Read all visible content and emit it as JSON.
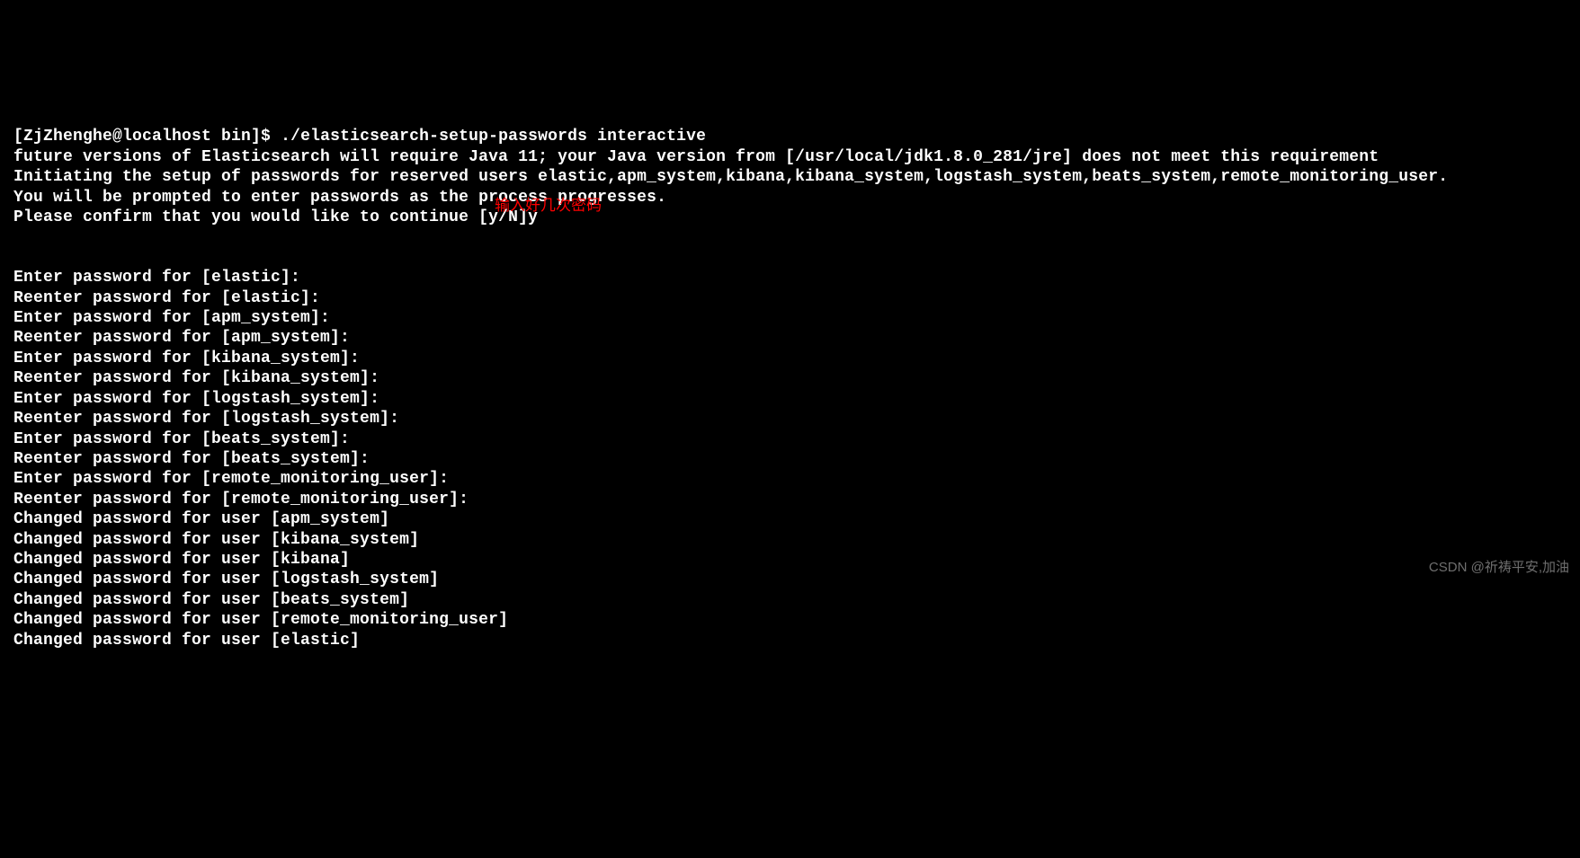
{
  "terminal": {
    "prompt": "[ZjZhenghe@localhost bin]$ ",
    "command": "./elasticsearch-setup-passwords interactive",
    "output": [
      "future versions of Elasticsearch will require Java 11; your Java version from [/usr/local/jdk1.8.0_281/jre] does not meet this requirement",
      "Initiating the setup of passwords for reserved users elastic,apm_system,kibana,kibana_system,logstash_system,beats_system,remote_monitoring_user.",
      "You will be prompted to enter passwords as the process progresses.",
      "Please confirm that you would like to continue [y/N]y",
      "",
      "",
      "Enter password for [elastic]: ",
      "Reenter password for [elastic]: ",
      "Enter password for [apm_system]: ",
      "Reenter password for [apm_system]: ",
      "Enter password for [kibana_system]: ",
      "Reenter password for [kibana_system]: ",
      "Enter password for [logstash_system]: ",
      "Reenter password for [logstash_system]: ",
      "Enter password for [beats_system]: ",
      "Reenter password for [beats_system]: ",
      "Enter password for [remote_monitoring_user]: ",
      "Reenter password for [remote_monitoring_user]: ",
      "Changed password for user [apm_system]",
      "Changed password for user [kibana_system]",
      "Changed password for user [kibana]",
      "Changed password for user [logstash_system]",
      "Changed password for user [beats_system]",
      "Changed password for user [remote_monitoring_user]",
      "Changed password for user [elastic]"
    ]
  },
  "annotation": "输入好几次密码",
  "watermark": "CSDN @祈祷平安,加油"
}
